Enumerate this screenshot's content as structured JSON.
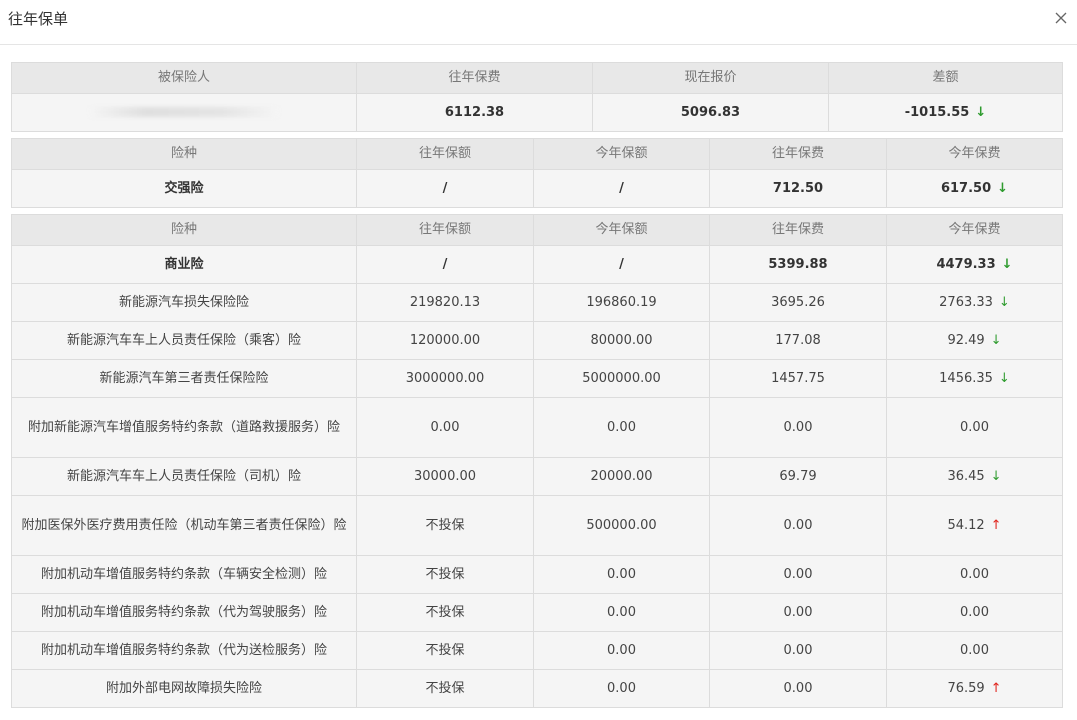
{
  "modal": {
    "title": "往年保单"
  },
  "summary": {
    "headers": [
      "被保险人",
      "往年保费",
      "现在报价",
      "差额"
    ],
    "insured_value": "",
    "prev_premium": "6112.38",
    "current_quote": "5096.83",
    "difference": "-1015.55",
    "difference_trend": "down"
  },
  "compulsory": {
    "headers": [
      "险种",
      "往年保额",
      "今年保额",
      "往年保费",
      "今年保费"
    ],
    "row": {
      "name": "交强险",
      "prev_amount": "/",
      "curr_amount": "/",
      "prev_premium": "712.50",
      "curr_premium": "617.50",
      "trend": "down"
    }
  },
  "commercial": {
    "headers": [
      "险种",
      "往年保额",
      "今年保额",
      "往年保费",
      "今年保费"
    ],
    "total": {
      "name": "商业险",
      "prev_amount": "/",
      "curr_amount": "/",
      "prev_premium": "5399.88",
      "curr_premium": "4479.33",
      "trend": "down"
    },
    "rows": [
      {
        "name": "新能源汽车损失保险险",
        "prev_amount": "219820.13",
        "curr_amount": "196860.19",
        "prev_premium": "3695.26",
        "curr_premium": "2763.33",
        "trend": "down"
      },
      {
        "name": "新能源汽车车上人员责任保险（乘客）险",
        "prev_amount": "120000.00",
        "curr_amount": "80000.00",
        "prev_premium": "177.08",
        "curr_premium": "92.49",
        "trend": "down"
      },
      {
        "name": "新能源汽车第三者责任保险险",
        "prev_amount": "3000000.00",
        "curr_amount": "5000000.00",
        "prev_premium": "1457.75",
        "curr_premium": "1456.35",
        "trend": "down"
      },
      {
        "name": "附加新能源汽车增值服务特约条款（道路救援服务）险",
        "prev_amount": "0.00",
        "curr_amount": "0.00",
        "prev_premium": "0.00",
        "curr_premium": "0.00",
        "trend": ""
      },
      {
        "name": "新能源汽车车上人员责任保险（司机）险",
        "prev_amount": "30000.00",
        "curr_amount": "20000.00",
        "prev_premium": "69.79",
        "curr_premium": "36.45",
        "trend": "down"
      },
      {
        "name": "附加医保外医疗费用责任险（机动车第三者责任保险）险",
        "prev_amount": "不投保",
        "curr_amount": "500000.00",
        "prev_premium": "0.00",
        "curr_premium": "54.12",
        "trend": "up"
      },
      {
        "name": "附加机动车增值服务特约条款（车辆安全检测）险",
        "prev_amount": "不投保",
        "curr_amount": "0.00",
        "prev_premium": "0.00",
        "curr_premium": "0.00",
        "trend": ""
      },
      {
        "name": "附加机动车增值服务特约条款（代为驾驶服务）险",
        "prev_amount": "不投保",
        "curr_amount": "0.00",
        "prev_premium": "0.00",
        "curr_premium": "0.00",
        "trend": ""
      },
      {
        "name": "附加机动车增值服务特约条款（代为送检服务）险",
        "prev_amount": "不投保",
        "curr_amount": "0.00",
        "prev_premium": "0.00",
        "curr_premium": "0.00",
        "trend": ""
      },
      {
        "name": "附加外部电网故障损失险险",
        "prev_amount": "不投保",
        "curr_amount": "0.00",
        "prev_premium": "0.00",
        "curr_premium": "76.59",
        "trend": "up"
      }
    ]
  },
  "icons": {
    "close": "close-icon",
    "trend_down": "arrow-down-icon",
    "trend_up": "arrow-up-icon"
  },
  "colors": {
    "trend_down": "#2e9b2e",
    "trend_up": "#e0241d",
    "header_bg": "#e8e8e8",
    "row_bg": "#f5f5f5"
  }
}
